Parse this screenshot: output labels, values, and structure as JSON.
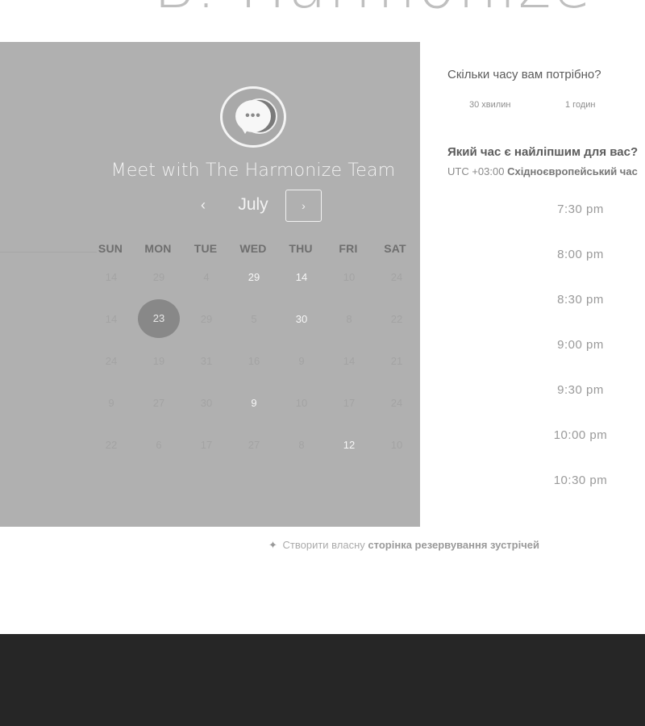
{
  "banner": {
    "text": "B. Harmonize"
  },
  "calendar": {
    "title": "Meet with The Harmonize Team",
    "logo_icon": "chat-bubble-icon",
    "logo_dots": "•••",
    "month": "July",
    "prev_icon": "‹",
    "next_icon": "›",
    "weekdays": [
      "SUN",
      "MON",
      "TUE",
      "WED",
      "THU",
      "FRI",
      "SAT"
    ],
    "weeks": [
      [
        "14",
        "29",
        "4",
        "29",
        "14",
        "10",
        "24"
      ],
      [
        "14",
        "23",
        "29",
        "5",
        "30",
        "8",
        "22"
      ],
      [
        "24",
        "19",
        "31",
        "16",
        "9",
        "14",
        "21"
      ],
      [
        "9",
        "27",
        "30",
        "9",
        "10",
        "17",
        "24"
      ],
      [
        "22",
        "6",
        "17",
        "27",
        "8",
        "12",
        "10"
      ]
    ],
    "selected_day": "23"
  },
  "booking": {
    "duration_question": "Скільки часу вам потрібно?",
    "duration_options": [
      "30 хвилин",
      "1 годин"
    ],
    "time_question": "Який час є найліпшим для вас?",
    "timezone_offset": "UTC +03:00",
    "timezone_name": "Східноєвропейський час",
    "time_slots": [
      "7:30 pm",
      "8:00 pm",
      "8:30 pm",
      "9:00 pm",
      "9:30 pm",
      "10:00 pm",
      "10:30 pm"
    ]
  },
  "footer": {
    "icon": "leaf-icon",
    "prefix": "Створити власну",
    "bold": "сторінка резервування зустрічей"
  }
}
